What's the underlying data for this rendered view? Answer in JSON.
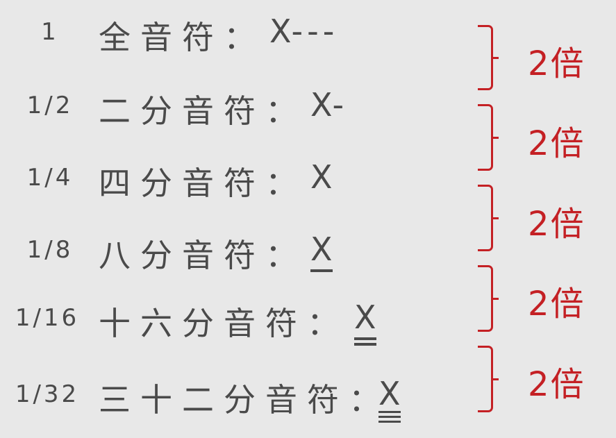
{
  "rows": [
    {
      "frac": "1",
      "name": "全音符：",
      "note": "X",
      "suffix": "---"
    },
    {
      "frac": "1/2",
      "name": "二分音符：",
      "note": "X",
      "suffix": "-"
    },
    {
      "frac": "1/4",
      "name": "四分音符：",
      "note": "X",
      "suffix": ""
    },
    {
      "frac": "1/8",
      "name": "八分音符：",
      "note": "X",
      "suffix": ""
    },
    {
      "frac": "1/16",
      "name": "十六分音符：",
      "note": "X",
      "suffix": ""
    },
    {
      "frac": "1/32",
      "name": "三十二分音符：",
      "note": "X",
      "suffix": ""
    }
  ],
  "ratios": [
    "2倍",
    "2倍",
    "2倍",
    "2倍",
    "2倍"
  ],
  "colors": {
    "text": "#4a4a4a",
    "accent": "#c42024",
    "background": "#e8e8e8"
  }
}
